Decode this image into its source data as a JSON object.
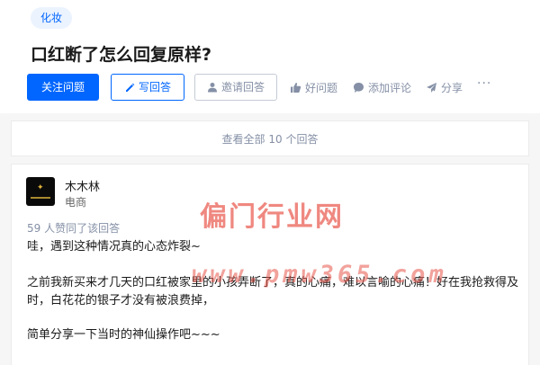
{
  "question": {
    "topic": "化妆",
    "title": "口红断了怎么回复原样?"
  },
  "toolbar": {
    "follow_label": "关注问题",
    "write_label": "写回答",
    "invite_label": "邀请回答",
    "like_label": "好问题",
    "comment_label": "添加评论",
    "share_label": "分享",
    "more_label": "···"
  },
  "answers_bar": {
    "view_all_label": "查看全部 10 个回答"
  },
  "answer": {
    "author_name": "木木林",
    "author_bio": "电商",
    "vote_text": "59 人赞同了该回答",
    "paragraphs": [
      "哇，遇到这种情况真的心态炸裂~",
      "之前我新买来才几天的口红被家里的小孩弄断了，真的心痛，难以言喻的心痛！好在我抢救得及时，白花花的银子才没有被浪费掉，",
      "简单分享一下当时的神仙操作吧~~~"
    ]
  },
  "watermark": {
    "title": "偏门行业网",
    "url": "www.pmw365.com"
  },
  "icons": {
    "write": "pen-icon",
    "invite": "person-icon",
    "like": "thumb-up-icon",
    "comment": "comment-bubble-icon",
    "share": "paper-plane-icon",
    "more": "more-dots-icon"
  },
  "colors": {
    "brand_blue": "#0066ff",
    "muted_text": "#8590a6",
    "watermark_red": "#e8564a"
  }
}
